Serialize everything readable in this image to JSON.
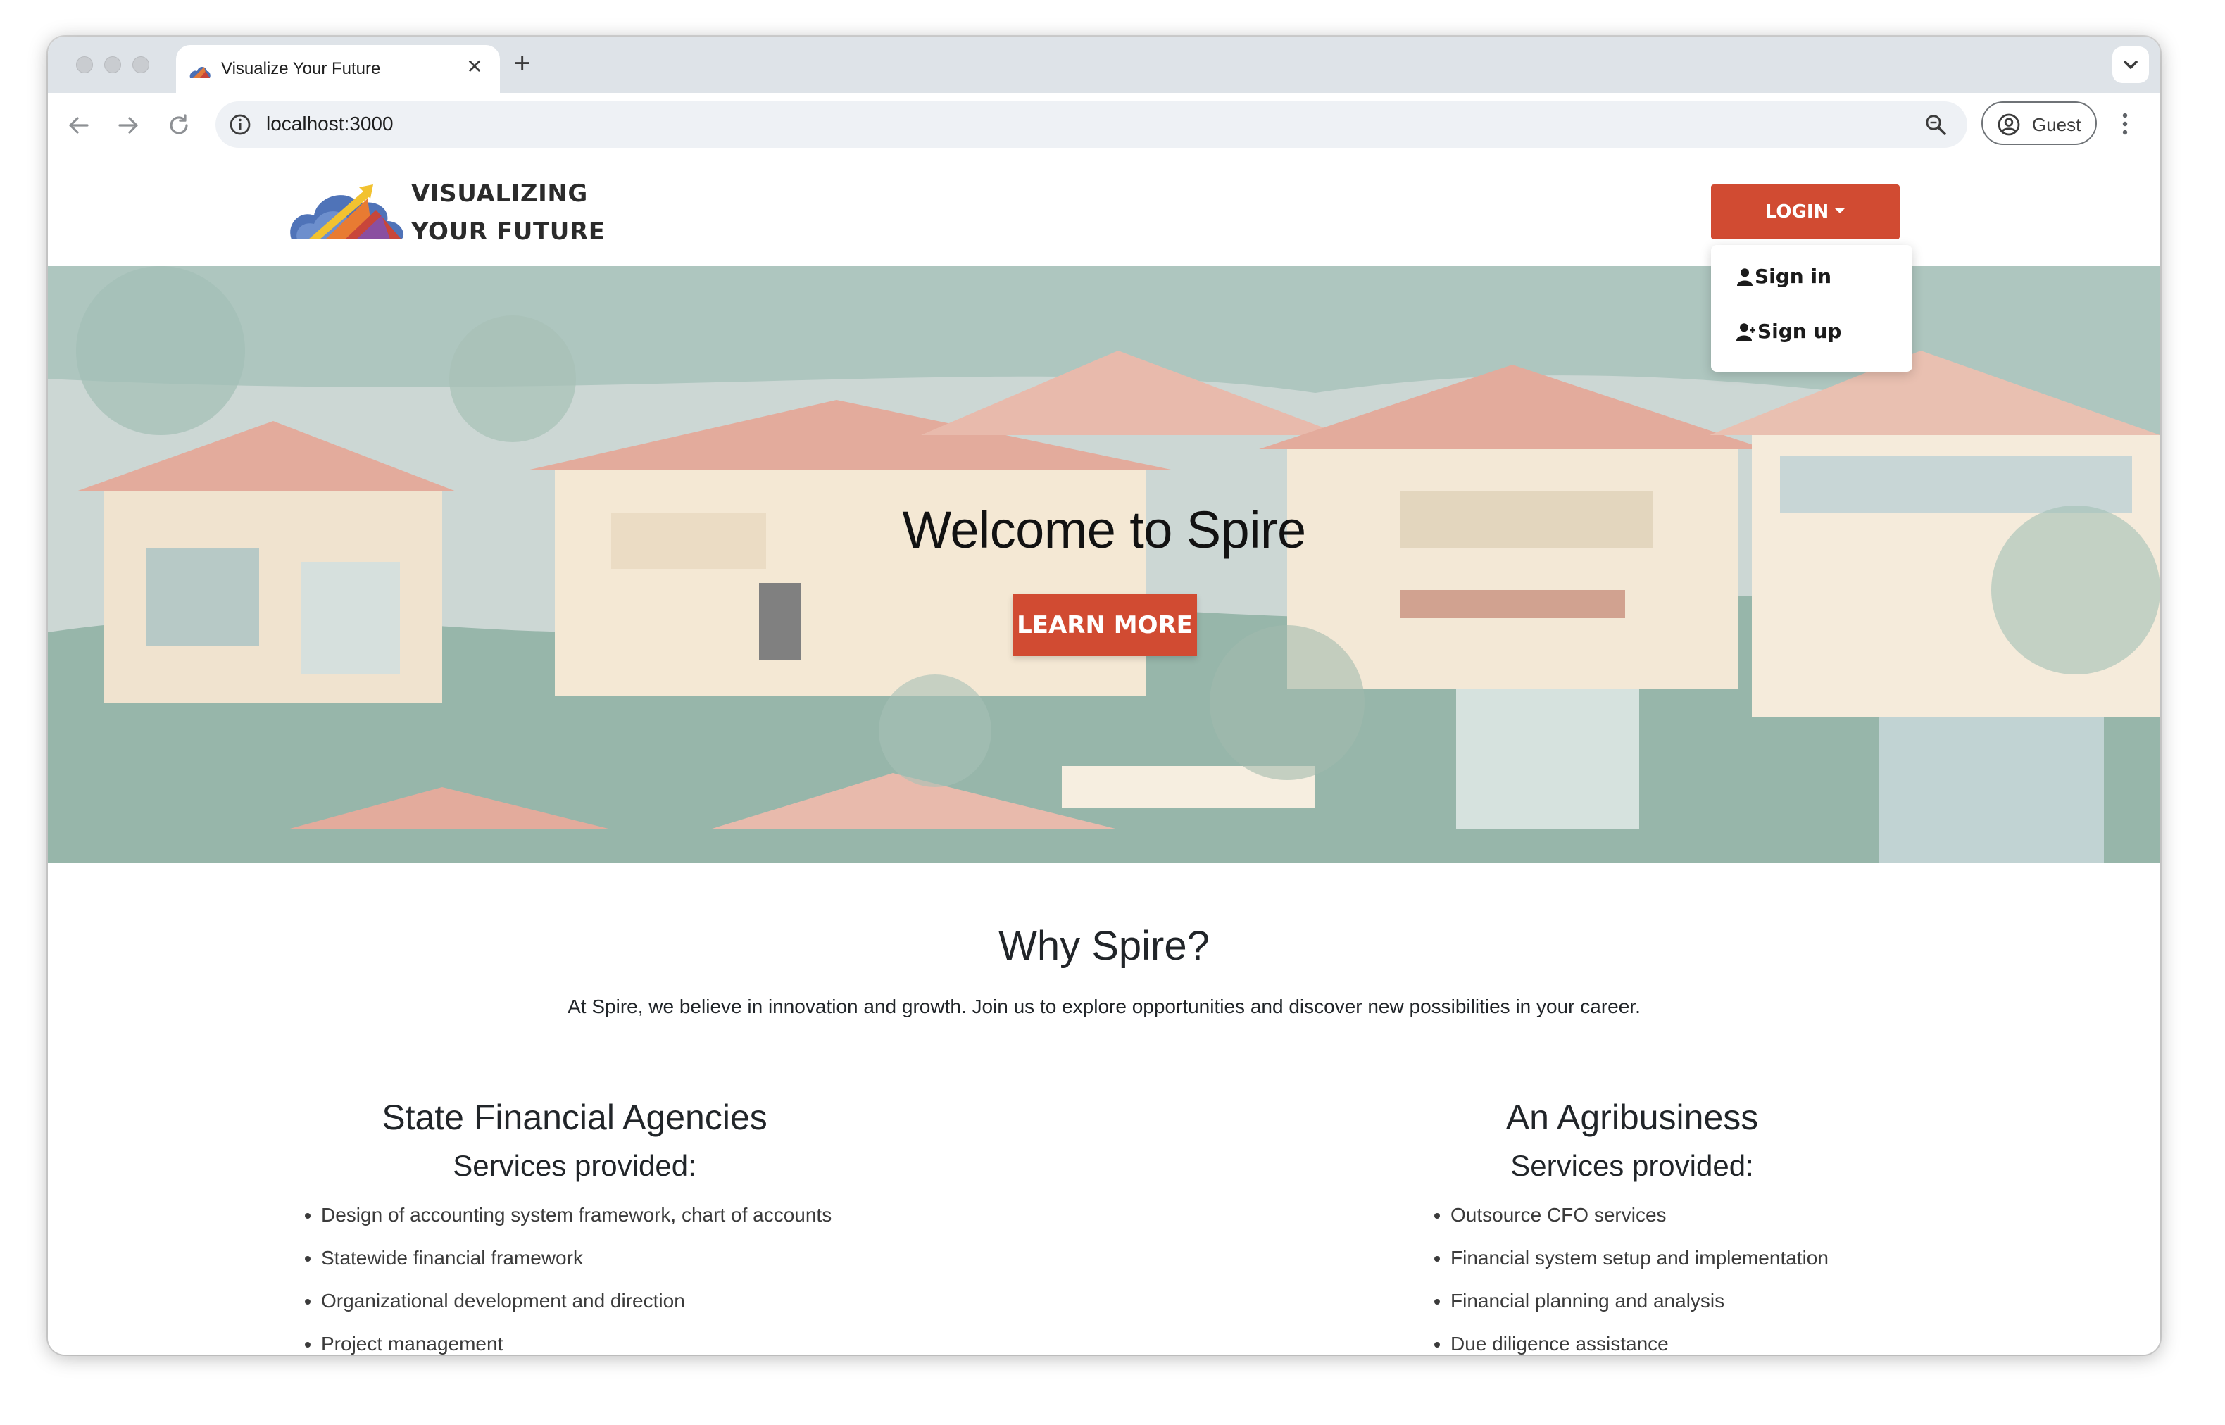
{
  "browser": {
    "tab_title": "Visualize Your Future",
    "tab_close": "✕",
    "new_tab": "+",
    "url": "localhost:3000",
    "profile_label": "Guest"
  },
  "navbar": {
    "brand_line1": "VISUALIZING",
    "brand_line2": "YOUR FUTURE",
    "login_label": "LOGIN",
    "dropdown": {
      "sign_in": "Sign in",
      "sign_up": "Sign up"
    }
  },
  "hero": {
    "title": "Welcome to Spire",
    "button_label": "LEARN MORE"
  },
  "why": {
    "title": "Why Spire?",
    "text": "At Spire, we believe in innovation and growth. Join us to explore opportunities and discover new possibilities in your career."
  },
  "columns": [
    {
      "title": "State Financial Agencies",
      "subtitle": "Services provided:",
      "items": [
        "Design of accounting system framework, chart of accounts",
        "Statewide financial framework",
        "Organizational development and direction",
        "Project management"
      ]
    },
    {
      "title": "An Agribusiness",
      "subtitle": "Services provided:",
      "items": [
        "Outsource CFO services",
        "Financial system setup and implementation",
        "Financial planning and analysis",
        "Due diligence assistance"
      ]
    }
  ],
  "colors": {
    "accent": "#d14b32",
    "tabstrip": "#dee3e8",
    "omnibox": "#eef1f5"
  },
  "icons": {
    "back": "back-arrow-icon",
    "forward": "forward-arrow-icon",
    "reload": "reload-icon",
    "info": "info-icon",
    "zoom": "zoom-icon",
    "profile": "profile-icon",
    "menu": "kebab-menu-icon",
    "user": "user-icon",
    "user_plus": "user-plus-icon"
  }
}
